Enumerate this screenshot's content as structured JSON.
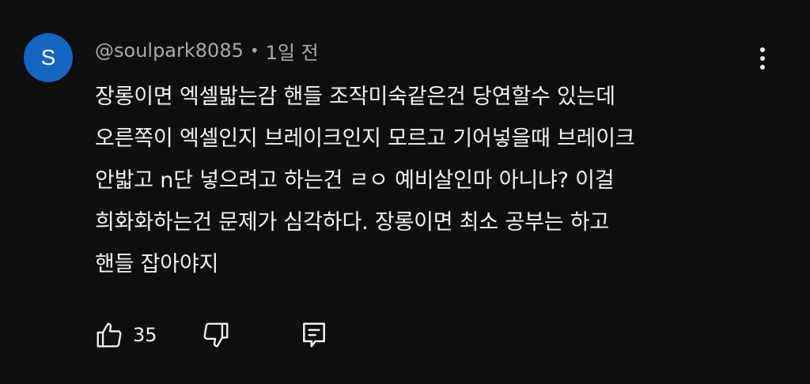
{
  "comment": {
    "avatar_letter": "S",
    "avatar_color": "#1565c0",
    "author": "@soulpark8085",
    "separator": "•",
    "time": "1일 전",
    "text_lines": [
      "장롱이면 엑셀밟는감 핸들 조작미숙같은건 당연할수 있는데",
      "오른쪽이 엑셀인지 브레이크인지 모르고 기어넣을때 브레이크",
      "안밟고 n단 넣으려고 하는건 ㄹㅇ 예비살인마 아니냐? 이걸",
      "희화화하는건 문제가 심각하다. 장롱이면 최소 공부는 하고",
      "핸들 잡아야지"
    ],
    "like_count": "35"
  },
  "icons": {
    "menu": "more-vertical-icon",
    "like": "thumbs-up-icon",
    "dislike": "thumbs-down-icon",
    "reply": "reply-comment-icon"
  },
  "colors": {
    "background": "#0f0f0f",
    "text": "#f1f1f1",
    "meta_text": "#aaaaaa"
  }
}
